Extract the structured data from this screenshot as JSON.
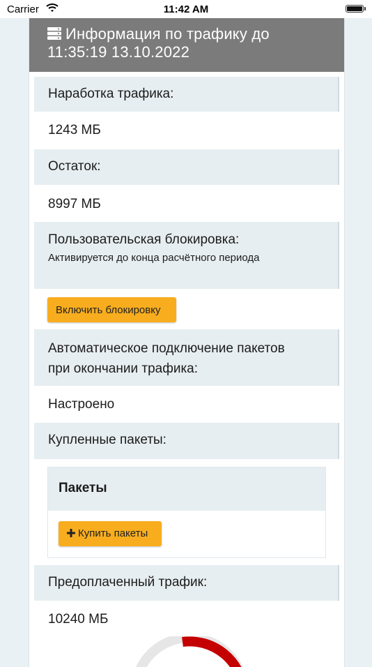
{
  "status_bar": {
    "carrier": "Carrier",
    "time": "11:42 AM"
  },
  "header": {
    "icon": "server-icon",
    "title_line1": "Информация по трафику до",
    "title_line2": "11:35:19 13.10.2022"
  },
  "traffic": {
    "usage_label": "Наработка трафика:",
    "usage_value": "1243 МБ",
    "remaining_label": "Остаток:",
    "remaining_value": "8997 МБ"
  },
  "user_block": {
    "label": "Пользовательская блокировка:",
    "note": "Активируется до конца расчётного периода",
    "button_label": "Включить блокировку"
  },
  "auto_packages": {
    "label_line1": "Автоматическое подключение пакетов",
    "label_line2": "при окончании трафика:",
    "value": "Настроено"
  },
  "packages": {
    "label": "Купленные пакеты:",
    "panel_title": "Пакеты",
    "buy_icon": "plus-icon",
    "buy_button_label": "Купить пакеты"
  },
  "prepaid": {
    "label": "Предоплаченный трафик:",
    "value": "10240 МБ"
  },
  "colors": {
    "header_bg": "#7b7b7b",
    "row_bg": "#e7eef1",
    "button_bg": "#f8ad1e",
    "gauge_used": "#c40000",
    "gauge_track": "#e6e6e6"
  }
}
